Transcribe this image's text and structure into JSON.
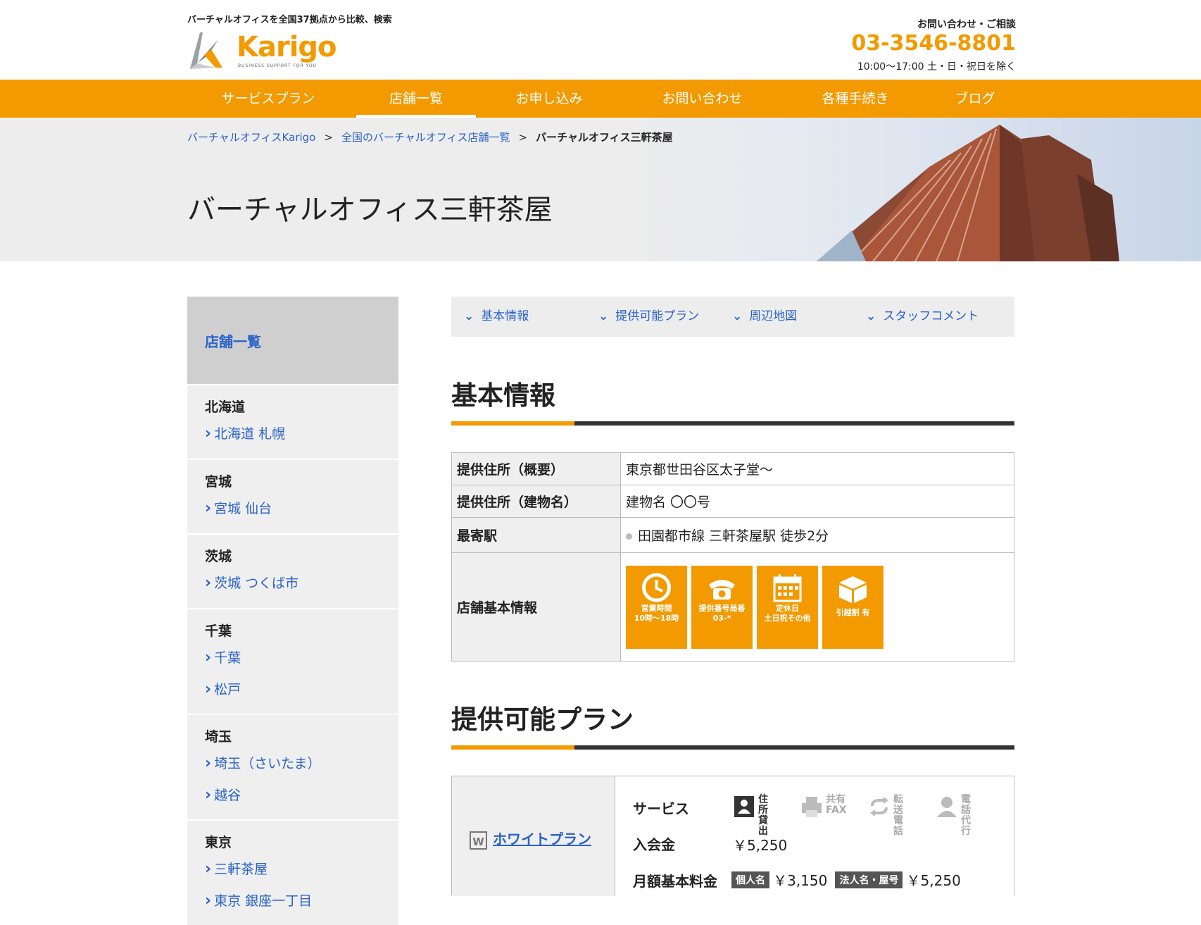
{
  "header": {
    "tagline": "バーチャルオフィスを全国37拠点から比較、検索",
    "logo_text": "Karigo",
    "logo_sub": "BUSINESS SUPPORT FOR YOU",
    "contact_label": "お問い合わせ・ご相談",
    "contact_phone": "03-3546-8801",
    "contact_hours": "10:00〜17:00 土・日・祝日を除く"
  },
  "nav": {
    "items": [
      "サービスプラン",
      "店舗一覧",
      "お申し込み",
      "お問い合わせ",
      "各種手続き",
      "ブログ"
    ],
    "active": "店舗一覧"
  },
  "breadcrumb": {
    "items": [
      "バーチャルオフィスKarigo",
      "全国のバーチャルオフィス店舗一覧"
    ],
    "separator": ">",
    "current": "バーチャルオフィス三軒茶屋"
  },
  "page_title": "バーチャルオフィス三軒茶屋",
  "sidebar": {
    "title": "店舗一覧",
    "groups": [
      {
        "region": "北海道",
        "links": [
          "北海道 札幌"
        ]
      },
      {
        "region": "宮城",
        "links": [
          "宮城 仙台"
        ]
      },
      {
        "region": "茨城",
        "links": [
          "茨城 つくば市"
        ]
      },
      {
        "region": "千葉",
        "links": [
          "千葉",
          "松戸"
        ]
      },
      {
        "region": "埼玉",
        "links": [
          "埼玉（さいたま）",
          "越谷"
        ]
      },
      {
        "region": "東京",
        "links": [
          "三軒茶屋",
          "東京 銀座一丁目"
        ]
      }
    ]
  },
  "tabs": [
    "基本情報",
    "提供可能プラン",
    "周辺地図",
    "スタッフコメント"
  ],
  "basic": {
    "title": "基本情報",
    "rows": [
      {
        "key": "提供住所（概要）",
        "value": "東京都世田谷区太子堂〜"
      },
      {
        "key": "提供住所（建物名）",
        "value": "建物名 〇〇号"
      },
      {
        "key": "最寄駅",
        "value": "田園都市線 三軒茶屋駅 徒歩2分"
      },
      {
        "key": "店舗基本情報",
        "value": ""
      }
    ],
    "features": [
      {
        "icon": "clock-icon",
        "line1": "営業時間",
        "line2": "10時〜18時"
      },
      {
        "icon": "phone-icon",
        "line1": "提供番号局番",
        "line2": "03-*"
      },
      {
        "icon": "calendar-icon",
        "line1": "定休日",
        "line2": "土日祝その他"
      },
      {
        "icon": "box-icon",
        "line1": "引越割 有",
        "line2": ""
      }
    ]
  },
  "plans": {
    "title": "提供可能プラン",
    "plan_badge": "W",
    "plan_name": "ホワイトプラン",
    "service_label": "サービス",
    "services": [
      {
        "icon": "address-icon",
        "line1": "住所",
        "line2": "貸出",
        "active": true
      },
      {
        "icon": "fax-icon",
        "line1": "共有",
        "line2": "FAX",
        "active": false
      },
      {
        "icon": "transfer-icon",
        "line1": "転送",
        "line2": "電話",
        "active": false
      },
      {
        "icon": "operator-icon",
        "line1": "電話",
        "line2": "代行",
        "active": false
      }
    ],
    "entry_label": "入会金",
    "entry_fee": "￥5,250",
    "monthly_label": "月額基本料金",
    "individual_tag": "個人名",
    "individual_price": "￥3,150",
    "corporate_tag": "法人名・屋号",
    "corporate_price": "￥5,250"
  },
  "colors": {
    "accent": "#f29a00",
    "link": "#2a62c9",
    "dark": "#333333"
  }
}
